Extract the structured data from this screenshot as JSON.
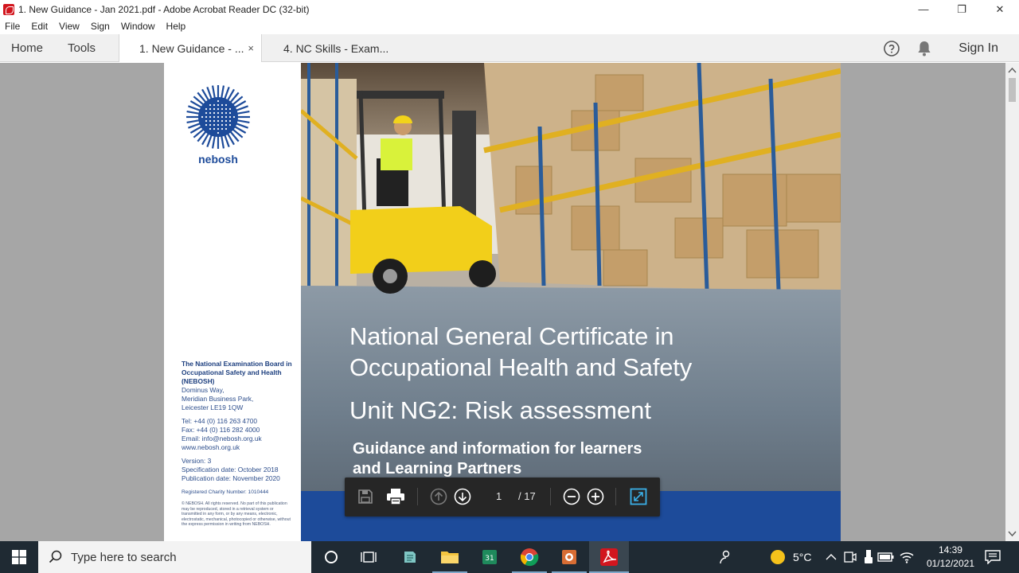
{
  "window": {
    "title": "1. New Guidance - Jan 2021.pdf - Adobe Acrobat Reader DC (32-bit)",
    "controls": {
      "minimize": "—",
      "restore": "❐",
      "close": "✕"
    }
  },
  "menu": [
    "File",
    "Edit",
    "View",
    "Sign",
    "Window",
    "Help"
  ],
  "tabs": {
    "home": "Home",
    "tools": "Tools",
    "documents": [
      {
        "label": "1. New Guidance - ...",
        "active": true,
        "close": "×"
      },
      {
        "label": "4. NC Skills - Exam...",
        "active": false
      }
    ],
    "help_icon": "question-circle-icon",
    "bell_icon": "bell-icon",
    "sign_in": "Sign In"
  },
  "document": {
    "logo_text": "nebosh",
    "org_name": "The National Examination Board in Occupational Safety and Health (NEBOSH)",
    "address": [
      "Dominus Way,",
      "Meridian Business Park,",
      "Leicester LE19 1QW"
    ],
    "contact": [
      "Tel: +44 (0) 116 263 4700",
      "Fax: +44 (0) 116 282 4000",
      "Email: info@nebosh.org.uk",
      "www.nebosh.org.uk"
    ],
    "versions": [
      "Version: 3",
      "Specification date: October 2018",
      "Publication date: November 2020"
    ],
    "charity": "Registered Charity Number: 1010444",
    "copyright": "© NEBOSH. All rights reserved. No part of this publication may be reproduced, stored in a retrieval system or transmitted in any form, or by any means, electronic, electrostatic, mechanical, photocopied or otherwise, without the express permission in writing from NEBOSH.",
    "title_line1": "National General Certificate in",
    "title_line2": "Occupational Health and Safety",
    "unit": "Unit NG2: Risk assessment",
    "subtitle_line1": "Guidance and information for learners",
    "subtitle_line2": "and Learning Partners",
    "brand_blue": "#1d4b9a"
  },
  "floating_toolbar": {
    "current_page": "1",
    "total_pages": "/ 17"
  },
  "taskbar": {
    "search_placeholder": "Type here to search",
    "weather": "5°C",
    "time": "14:39",
    "date": "01/12/2021"
  }
}
